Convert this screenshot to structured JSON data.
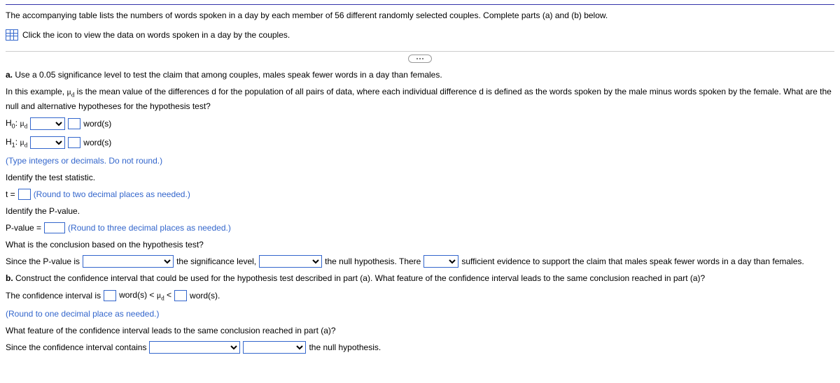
{
  "intro": {
    "p1": "The accompanying table lists the numbers of words spoken in a day by each member of 56 different randomly selected couples. Complete parts (a) and (b) below.",
    "link": "Click the icon to view the data on words spoken in a day by the couples."
  },
  "a": {
    "prompt_bold": "a.",
    "prompt": " Use a 0.05 significance level to test the claim that among couples, males speak fewer words in a day than females.",
    "explain_pre": "In this example, ",
    "explain_post": " is the mean value of the differences d for the population of all pairs of data, where each individual difference d is defined as the words spoken by the male minus words spoken by the female. What are the null and alternative hypotheses for the hypothesis test?",
    "h0_units": "word(s)",
    "h1_units": "word(s)",
    "type_hint": "(Type integers or decimals. Do not round.)",
    "identify_stat": "Identify the test statistic.",
    "t_label": "t =",
    "t_hint": "(Round to two decimal places as needed.)",
    "identify_p": "Identify the P-value.",
    "p_label": "P-value =",
    "p_hint": "(Round to three decimal places as needed.)",
    "conclusion_q": "What is the conclusion based on the hypothesis test?",
    "conc": {
      "s1": "Since the P-value is",
      "s2": "the significance level,",
      "s3": "the null hypothesis. There",
      "s4": "sufficient evidence to support the claim that males speak fewer words in a day than females."
    }
  },
  "b": {
    "prompt_bold": "b.",
    "prompt": " Construct the confidence interval that could be used for the hypothesis test described in part (a). What feature of the confidence interval leads to the same conclusion reached in part (a)?",
    "ci_pre": "The confidence interval is",
    "ci_units1": "word(s) < ",
    "ci_units2": " <",
    "ci_units3": "word(s).",
    "ci_hint": "(Round to one decimal place as needed.)",
    "feature_q": "What feature of the confidence interval leads to the same conclusion reached in part (a)?",
    "feat_pre": "Since the confidence interval contains",
    "feat_post": "the null hypothesis."
  }
}
